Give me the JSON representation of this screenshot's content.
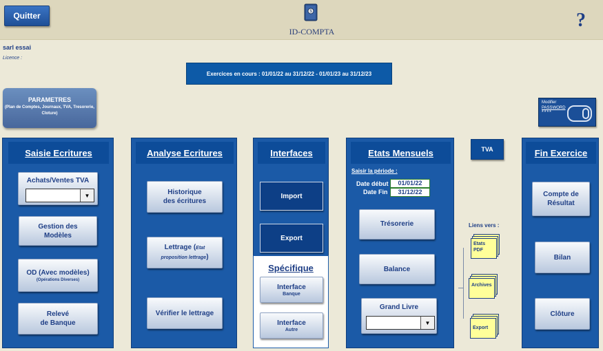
{
  "app": {
    "title": "ID-COMPTA",
    "quit_label": "Quitter",
    "help_glyph": "?"
  },
  "company": {
    "name": "sarl essai",
    "licence_label": "Licence :"
  },
  "exercices_text": "Exercices en cours : 01/01/22 au 31/12/22  -   01/01/23 au 31/12/23",
  "parametres": {
    "title": "PARAMETRES",
    "subtitle": "(Plan de Comptes, Journaux, TVA, Tresorerie, Cloture)"
  },
  "password": {
    "modifier": "Modifier",
    "label": "PASSWORD",
    "stars": "****"
  },
  "saisie": {
    "title": "Saisie Ecritures",
    "achats_label": "Achats/Ventes TVA",
    "gestion_label_1": "Gestion des",
    "gestion_label_2": "Modèles",
    "od_label": "OD (Avec modèles)",
    "od_sub": "(Opérations Diverses)",
    "releve_label_1": "Relevé",
    "releve_label_2": "de Banque"
  },
  "analyse": {
    "title": "Analyse Ecritures",
    "historique_1": "Historique",
    "historique_2": "des écritures",
    "lettrage_1": "Lettrage (",
    "lettrage_it_1": "Etat",
    "lettrage_it_2": "proposition lettrage",
    "lettrage_end": ")",
    "verifier": "Vérifier le lettrage"
  },
  "interfaces": {
    "title": "Interfaces",
    "import": "Import",
    "export": "Export",
    "specifique": "Spécifique",
    "banque_1": "Interface",
    "banque_2": "Banque",
    "autre_1": "Interface",
    "autre_2": "Autre"
  },
  "etats": {
    "title": "Etats Mensuels",
    "periode": "Saisir la période :",
    "date_debut_label": "Date début",
    "date_debut": "01/01/22",
    "date_fin_label": "Date Fin",
    "date_fin": "31/12/22",
    "tresorerie": "Trésorerie",
    "balance": "Balance",
    "grand_livre": "Grand Livre"
  },
  "tva": {
    "label": "TVA"
  },
  "liens": {
    "title": "Liens vers :",
    "pdf_1": "Etats",
    "pdf_2": "PDF",
    "archives": "Archives",
    "export": "Export"
  },
  "fin": {
    "title": "Fin Exercice",
    "compte_1": "Compte de",
    "compte_2": "Résultat",
    "bilan": "Bilan",
    "cloture": "Clôture"
  }
}
